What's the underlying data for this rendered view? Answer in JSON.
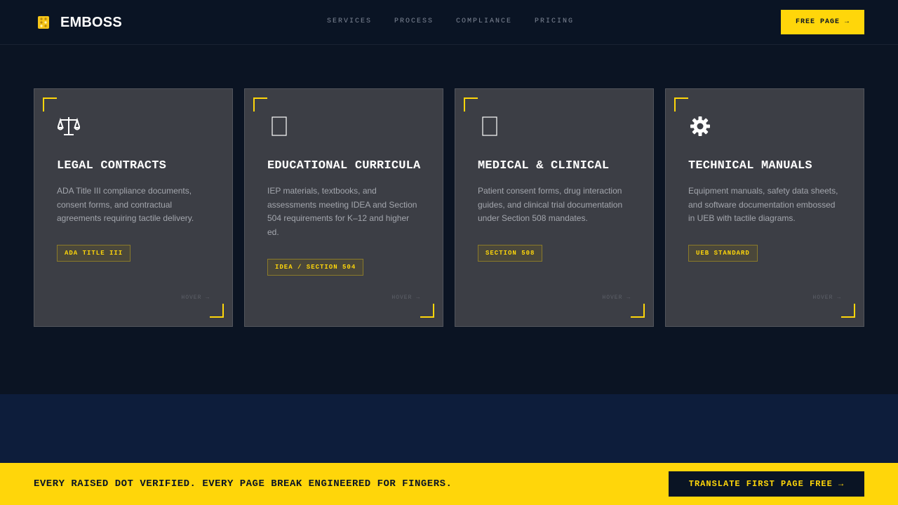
{
  "header": {
    "brand": "EMBOSS",
    "brand_icon": "braille-icon",
    "nav": [
      {
        "label": "SERVICES"
      },
      {
        "label": "PROCESS"
      },
      {
        "label": "COMPLIANCE"
      },
      {
        "label": "PRICING"
      }
    ],
    "cta_label": "FREE PAGE →"
  },
  "cards": [
    {
      "icon": "scales-icon",
      "title": "LEGAL CONTRACTS",
      "description": "ADA Title III compliance documents, consent forms, and contractual agreements requiring tactile delivery.",
      "tag": "ADA TITLE III",
      "hover_hint": "HOVER →"
    },
    {
      "icon": "book-icon",
      "title": "EDUCATIONAL CURRICULA",
      "description": "IEP materials, textbooks, and assessments meeting IDEA and Section 504 requirements for K–12 and higher ed.",
      "tag": "IDEA / SECTION 504",
      "hover_hint": "HOVER →"
    },
    {
      "icon": "medical-icon",
      "title": "MEDICAL & CLINICAL",
      "description": "Patient consent forms, drug interaction guides, and clinical trial documentation under Section 508 mandates.",
      "tag": "SECTION 508",
      "hover_hint": "HOVER →"
    },
    {
      "icon": "gear-icon",
      "title": "TECHNICAL MANUALS",
      "description": "Equipment manuals, safety data sheets, and software documentation embossed in UEB with tactile diagrams.",
      "tag": "UEB STANDARD",
      "hover_hint": "HOVER →"
    }
  ],
  "banner": {
    "text": "EVERY RAISED DOT VERIFIED. EVERY PAGE BREAK ENGINEERED FOR FINGERS.",
    "button_label": "TRANSLATE FIRST PAGE FREE →"
  },
  "colors": {
    "background": "#0b1423",
    "accent": "#ffd60a",
    "card": "#3c3e45",
    "section2": "#0d1d3b"
  }
}
